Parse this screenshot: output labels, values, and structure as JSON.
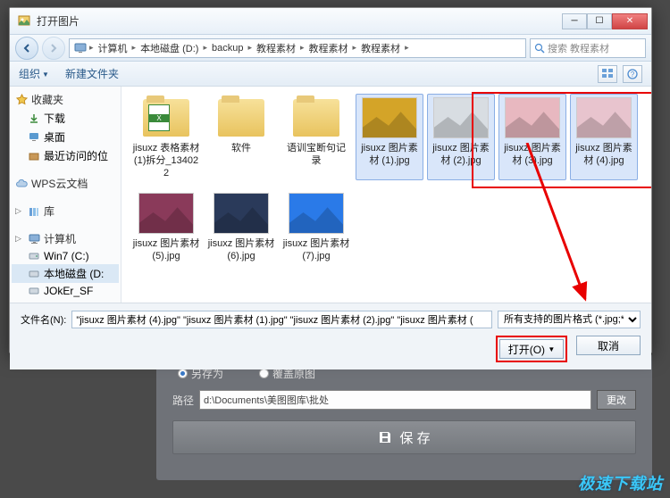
{
  "title": "打开图片",
  "breadcrumb": {
    "items": [
      "计算机",
      "本地磁盘 (D:)",
      "backup",
      "教程素材",
      "教程素材",
      "教程素材"
    ]
  },
  "search": {
    "placeholder": "搜索 教程素材"
  },
  "toolbar": {
    "organize": "组织",
    "new_folder": "新建文件夹"
  },
  "sidebar": {
    "favorites": "收藏夹",
    "downloads": "下载",
    "desktop": "桌面",
    "recent": "最近访问的位",
    "wps": "WPS云文档",
    "libraries": "库",
    "computer": "计算机",
    "win7": "Win7 (C:)",
    "local_d": "本地磁盘 (D:",
    "joker": "JOkEr_SF"
  },
  "files": [
    {
      "name": "jisuxz 表格素材 (1)拆分_134022",
      "type": "folder-excel"
    },
    {
      "name": "软件",
      "type": "folder"
    },
    {
      "name": "语训宝断句记录",
      "type": "folder"
    },
    {
      "name": "jisuxz 图片素材 (1).jpg",
      "type": "image",
      "color": "#d4a428",
      "selected": true
    },
    {
      "name": "jisuxz 图片素材 (2).jpg",
      "type": "image",
      "color": "#d8dde2",
      "selected": true
    },
    {
      "name": "jisuxz 图片素材 (3).jpg",
      "type": "image",
      "color": "#e8b8c0",
      "selected": true
    },
    {
      "name": "jisuxz 图片素材 (4).jpg",
      "type": "image",
      "color": "#e8c4ce",
      "selected": true
    },
    {
      "name": "jisuxz 图片素材 (5).jpg",
      "type": "image",
      "color": "#8a3a5a"
    },
    {
      "name": "jisuxz 图片素材 (6).jpg",
      "type": "image",
      "color": "#2a3a5a"
    },
    {
      "name": "jisuxz 图片素材 (7).jpg",
      "type": "image",
      "color": "#2a7ae8"
    }
  ],
  "filename_label": "文件名(N):",
  "filename_value": "\"jisuxz 图片素材 (4).jpg\" \"jisuxz 图片素材 (1).jpg\" \"jisuxz 图片素材 (2).jpg\" \"jisuxz 图片素材 (",
  "filter_value": "所有支持的图片格式 (*.jpg;*.jp",
  "open_label": "打开(O)",
  "cancel_label": "取消",
  "back_panel": {
    "save_as": "另存为",
    "overwrite": "覆盖原图",
    "path_label": "路径",
    "path_value": "d:\\Documents\\美图图库\\批处",
    "change": "更改",
    "save": "保 存"
  },
  "watermark": "极速下载站"
}
